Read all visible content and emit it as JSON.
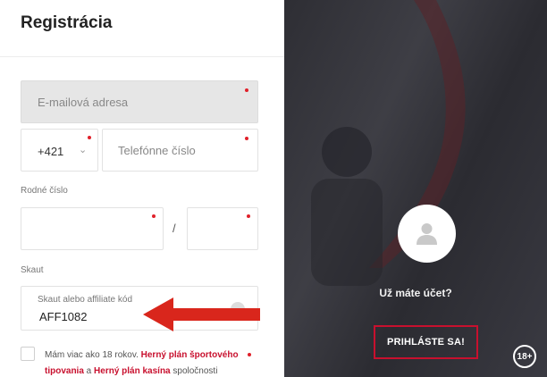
{
  "form": {
    "title": "Registrácia",
    "email_placeholder": "E-mailová adresa",
    "phone_prefix": "+421",
    "phone_placeholder": "Telefónne číslo",
    "birth_label": "Rodné číslo",
    "birth_separator": "/",
    "scout_label": "Skaut",
    "scout_field_label": "Skaut alebo affiliate kód",
    "scout_value": "AFF1082",
    "consent": {
      "text_1": "Mám viac ako 18 rokov. ",
      "link_1": "Herný plán športového tipovania",
      "text_2": " a ",
      "link_2": "Herný plán kasína",
      "text_3": " spoločnosti DOXXbet,"
    }
  },
  "side": {
    "question": "Už máte účet?",
    "login_label": "PRIHLÁSTE SA!",
    "age_badge": "18+"
  },
  "colors": {
    "accent": "#c8102e",
    "required_dot": "#e0202a",
    "annotation_arrow": "#d9261c",
    "side_panel": "#34343b"
  },
  "icons": {
    "avatar": "user-icon",
    "prefix_dropdown": "chevron-down-icon",
    "annotation": "arrow-left-icon"
  }
}
